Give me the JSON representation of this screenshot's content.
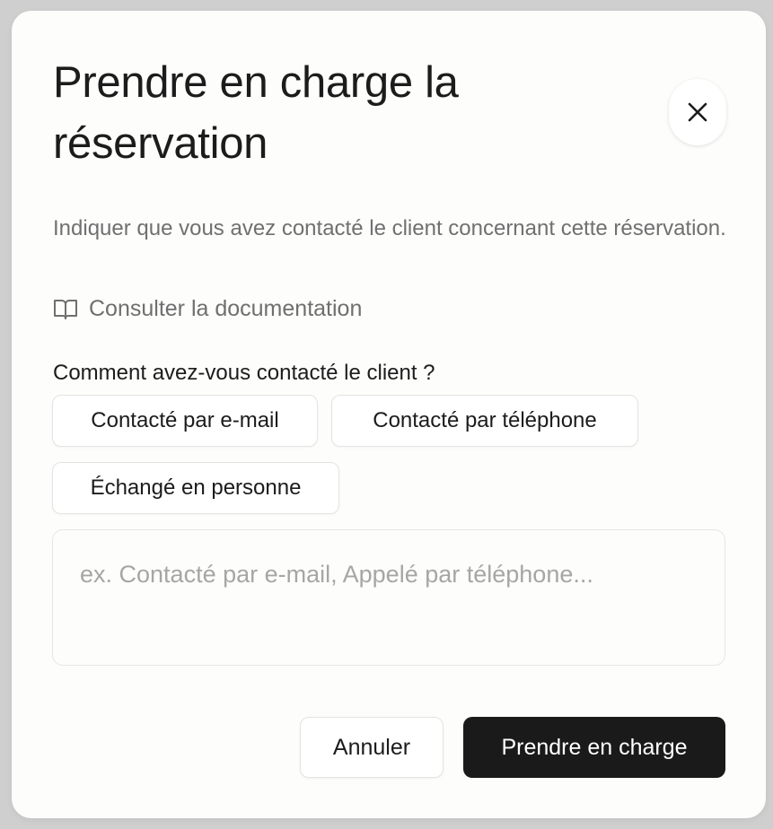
{
  "dialog": {
    "title": "Prendre en charge la réservation",
    "description": "Indiquer que vous avez contacté le client concernant cette réservation.",
    "close_icon": "close-icon",
    "doc_link": {
      "icon": "book-open-icon",
      "label": "Consulter la documentation"
    },
    "question": "Comment avez-vous contacté le client ?",
    "options": [
      {
        "label": "Contacté par e-mail"
      },
      {
        "label": "Contacté par téléphone"
      },
      {
        "label": "Échangé en personne"
      }
    ],
    "note": {
      "value": "",
      "placeholder": "ex. Contacté par e-mail, Appelé par téléphone..."
    },
    "actions": {
      "cancel_label": "Annuler",
      "confirm_label": "Prendre en charge"
    }
  },
  "colors": {
    "backdrop": "#cfcfcf",
    "surface": "#fdfdfc",
    "primary_button": "#1a1a1a",
    "muted_text": "#707070",
    "border": "#e4e4e2"
  }
}
